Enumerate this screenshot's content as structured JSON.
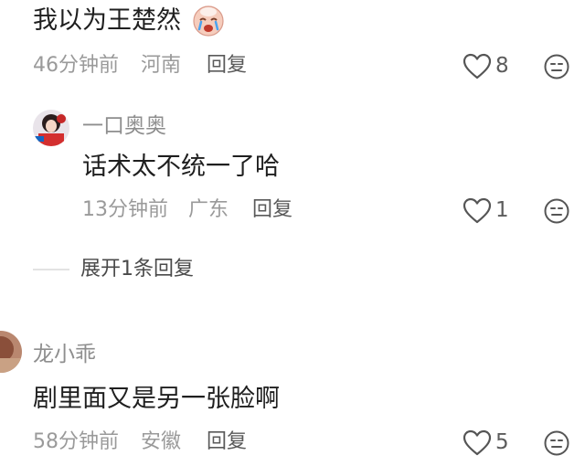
{
  "comment_1": {
    "text": "我以为王楚然",
    "emoji_icon": "crying-face-icon",
    "time": "46分钟前",
    "location": "河南",
    "reply_label": "回复",
    "likes": "8"
  },
  "reply_1": {
    "username": "一口奥奥",
    "text": "话术太不统一了哈",
    "time": "13分钟前",
    "location": "广东",
    "reply_label": "回复",
    "likes": "1"
  },
  "expand_replies": {
    "label": "展开1条回复"
  },
  "comment_2": {
    "username": "龙小乖",
    "text": "剧里面又是另一张脸啊",
    "time": "58分钟前",
    "location": "安徽",
    "reply_label": "回复",
    "likes": "5"
  },
  "colors": {
    "text": "#1f1f1f",
    "meta": "#9a9a9a",
    "icon": "#555555"
  }
}
